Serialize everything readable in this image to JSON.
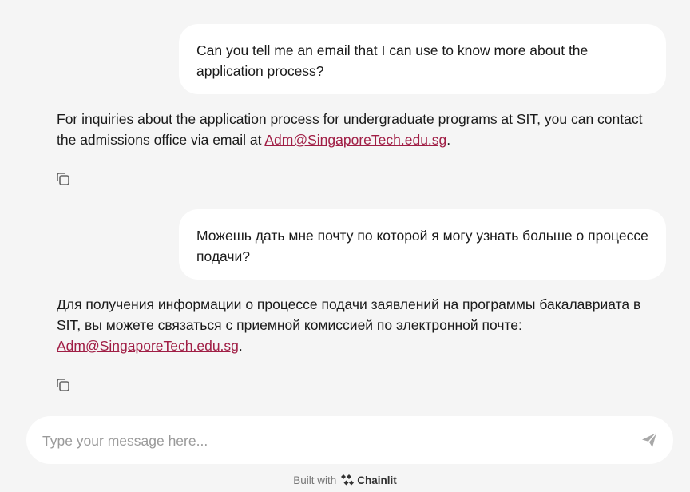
{
  "messages": [
    {
      "role": "user",
      "text": "Can you tell me an email that I can use to know more about the application process?"
    },
    {
      "role": "assistant",
      "text_before": "For inquiries about the application process for undergraduate programs at SIT, you can contact the admissions office via email at ",
      "link": "Adm@SingaporeTech.edu.sg",
      "text_after": "."
    },
    {
      "role": "user",
      "text": "Можешь дать мне почту по которой я могу узнать больше о процессе подачи?"
    },
    {
      "role": "assistant",
      "text_before": "Для получения информации о процессе подачи заявлений на программы бакалавриата в SIT, вы можете связаться с приемной комиссией по электронной почте: ",
      "link": "Adm@SingaporeTech.edu.sg",
      "text_after": "."
    }
  ],
  "composer": {
    "placeholder": "Type your message here...",
    "value": ""
  },
  "footer": {
    "built_with": "Built with",
    "brand": "Chainlit"
  },
  "icons": {
    "copy": "copy-icon",
    "send": "send-icon",
    "brand_logo": "chainlit-logo-icon"
  },
  "colors": {
    "background": "#f5f5f5",
    "bubble": "#ffffff",
    "link": "#a01e45"
  }
}
